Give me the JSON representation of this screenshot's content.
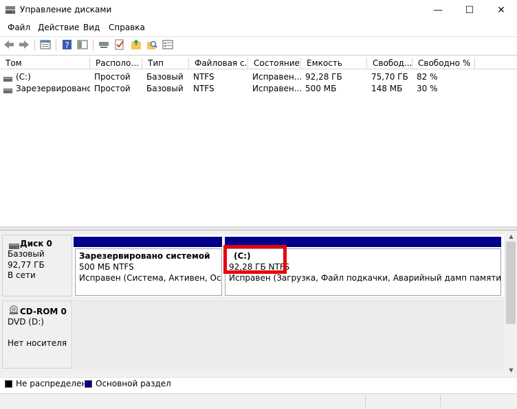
{
  "window": {
    "title": "Управление дисками",
    "controls": {
      "minimize": "—",
      "maximize": "☐",
      "close": "✕"
    }
  },
  "menu": [
    "Файл",
    "Действие",
    "Вид",
    "Справка"
  ],
  "toolbar": {
    "icons": [
      "back-icon",
      "forward-icon",
      "properties-icon",
      "help-icon",
      "show-pane-icon",
      "connect-disk-icon",
      "check-icon",
      "open-folder-icon",
      "search-icon",
      "console-icon"
    ]
  },
  "volume_list": {
    "columns": [
      "Том",
      "Располо...",
      "Тип",
      "Файловая с...",
      "Состояние",
      "Емкость",
      "Свобод...",
      "Свободно %"
    ],
    "rows": [
      {
        "name": "(C:)",
        "layout": "Простой",
        "type": "Базовый",
        "fs": "NTFS",
        "status": "Исправен...",
        "capacity": "92,28 ГБ",
        "free": "75,70 ГБ",
        "free_pct": "82 %"
      },
      {
        "name": "Зарезервировано...",
        "layout": "Простой",
        "type": "Базовый",
        "fs": "NTFS",
        "status": "Исправен...",
        "capacity": "500 МБ",
        "free": "148 МБ",
        "free_pct": "30 %"
      }
    ]
  },
  "disks": {
    "disk0": {
      "name": "Диск 0",
      "type": "Базовый",
      "size": "92,77 ГБ",
      "state": "В сети",
      "partitions": [
        {
          "title": "Зарезервировано системой",
          "size_fs": "500 МБ NTFS",
          "status": "Исправен (Система, Активен, Основн"
        },
        {
          "title": "(C:)",
          "size_fs": "92,28 ГБ NTFS",
          "status": "Исправен (Загрузка, Файл подкачки, Аварийный дамп памяти, Основн"
        }
      ]
    },
    "cdrom0": {
      "name": "CD-ROM 0",
      "drive": "DVD (D:)",
      "media": "Нет носителя"
    }
  },
  "legend": [
    {
      "label": "Не распределена",
      "color": "#000000"
    },
    {
      "label": "Основной раздел",
      "color": "#00008b"
    }
  ],
  "colors": {
    "partition_bar": "#00008b",
    "highlight": "#e8000b"
  }
}
